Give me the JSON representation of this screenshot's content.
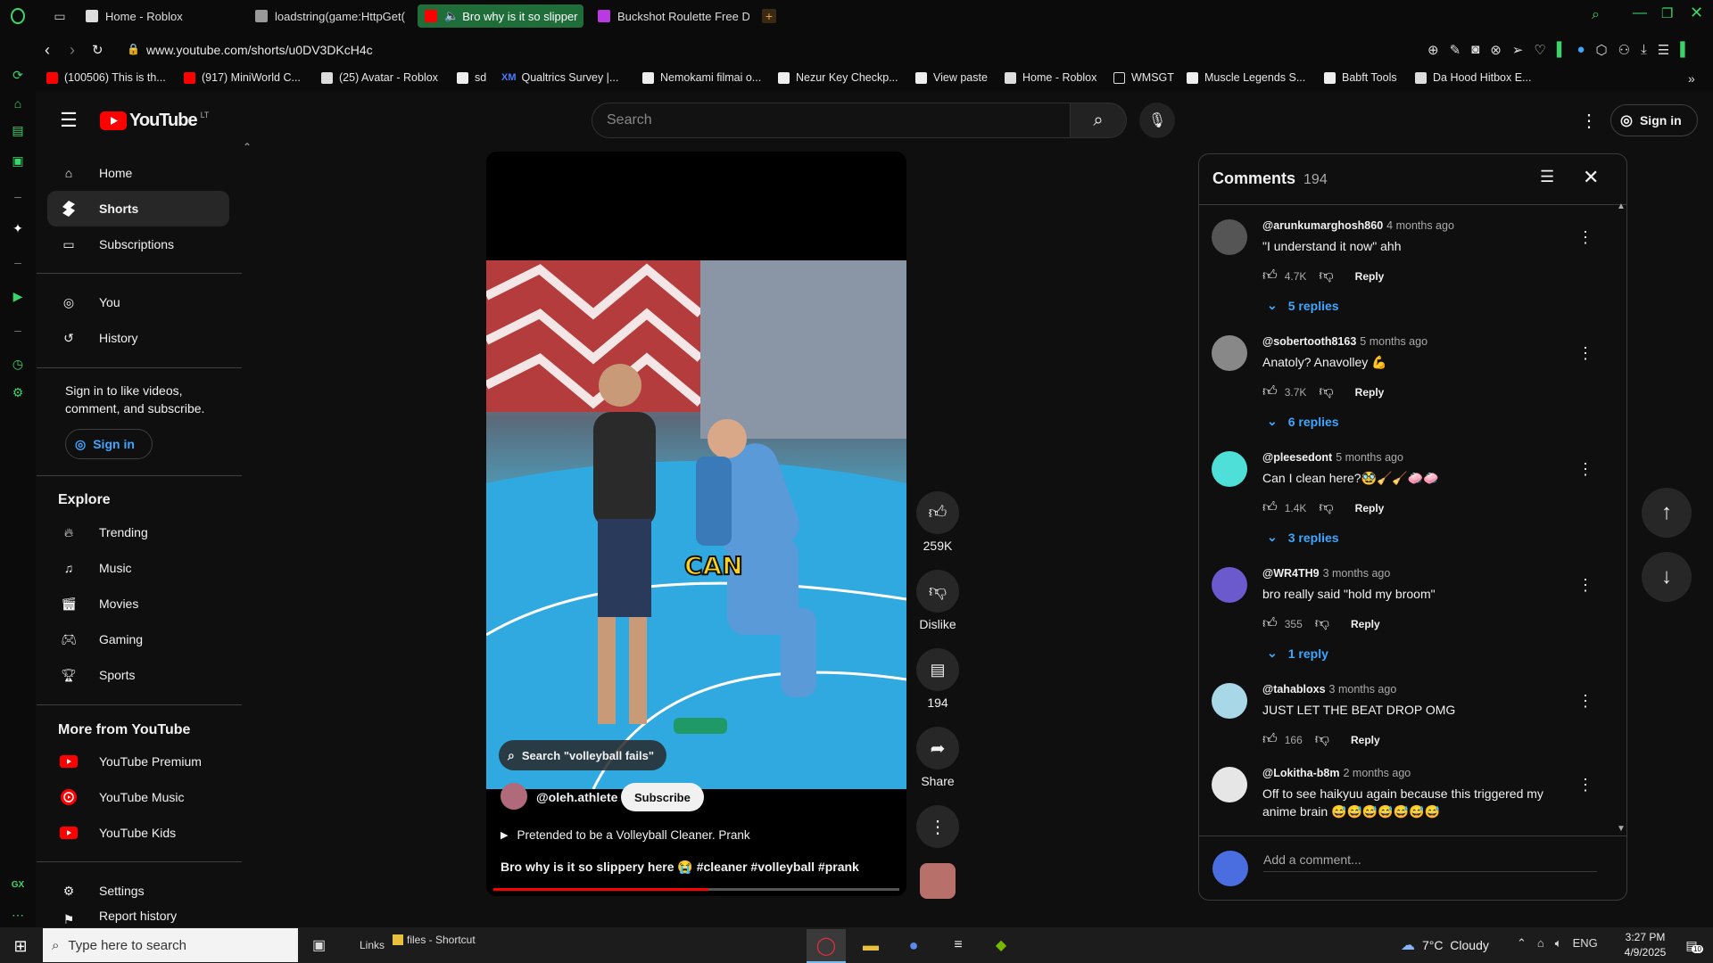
{
  "browser": {
    "tabs": [
      {
        "label": "Home - Roblox",
        "active": false
      },
      {
        "label": "loadstring(game:HttpGet(",
        "active": false
      },
      {
        "label": "Bro why is it so slipper",
        "active": true
      },
      {
        "label": "Buckshot Roulette Free D",
        "active": false
      }
    ],
    "new_tab": "+",
    "url": "www.youtube.com/shorts/u0DV3DKcH4c",
    "bookmarks": [
      "(100506) This is th...",
      "(917) MiniWorld C...",
      "(25) Avatar - Roblox",
      "sd",
      "Qualtrics Survey |...",
      "Nemokami filmai o...",
      "Nezur Key Checkp...",
      "View paste",
      "Home - Roblox",
      "WMSGT",
      "Muscle Legends S...",
      "Babft Tools",
      "Da Hood Hitbox E..."
    ],
    "bookmark_qualtrics_badge": "XM",
    "rail_badge": "GX",
    "accent": "#3ad46b"
  },
  "yt": {
    "logo": "YouTube",
    "country": "LT",
    "search_placeholder": "Search",
    "sign_in": "Sign in",
    "nav": {
      "home": "Home",
      "shorts": "Shorts",
      "subscriptions": "Subscriptions",
      "you": "You",
      "history": "History",
      "signin_prompt": "Sign in to like videos, comment, and subscribe.",
      "signin_button": "Sign in",
      "explore_heading": "Explore",
      "trending": "Trending",
      "music": "Music",
      "movies": "Movies",
      "gaming": "Gaming",
      "sports": "Sports",
      "more_heading": "More from YouTube",
      "premium": "YouTube Premium",
      "yt_music": "YouTube Music",
      "kids": "YouTube Kids",
      "settings": "Settings",
      "report": "Report history"
    }
  },
  "short": {
    "caption_word": "CAN",
    "search_chip": "Search \"volleyball fails\"",
    "channel": "@oleh.athlete",
    "subscribe": "Subscribe",
    "playlist": "Pretended to be a Volleyball Cleaner. Prank",
    "title": "Bro why is it so slippery here 😭 #cleaner #volleyball #prank",
    "progress": 0.53,
    "likes": "259K",
    "dislike": "Dislike",
    "comments": "194",
    "share": "Share"
  },
  "comments": {
    "title": "Comments",
    "count": "194",
    "add_placeholder": "Add a comment...",
    "reply_label": "Reply",
    "items": [
      {
        "author": "@arunkumarghosh860",
        "time": "4 months ago",
        "text": "\"I understand it now\" ahh",
        "likes": "4.7K",
        "replies": "5 replies",
        "avatar": "#555"
      },
      {
        "author": "@sobertooth8163",
        "time": "5 months ago",
        "text": "Anatoly? Anavolley 💪",
        "likes": "3.7K",
        "replies": "6 replies",
        "avatar": "#888"
      },
      {
        "author": "@pleesedont",
        "time": "5 months ago",
        "text": "Can I clean here?🥸🧹🧹🧼🧼",
        "likes": "1.4K",
        "replies": "3 replies",
        "avatar": "#4ee0d8"
      },
      {
        "author": "@WR4TH9",
        "time": "3 months ago",
        "text": "bro really said \"hold my broom\"",
        "likes": "355",
        "replies": "1 reply",
        "avatar": "#6a5acd"
      },
      {
        "author": "@tahabloxs",
        "time": "3 months ago",
        "text": "JUST LET THE BEAT DROP OMG",
        "likes": "166",
        "replies": "",
        "avatar": "#a8d8e8"
      },
      {
        "author": "@Lokitha-b8m",
        "time": "2 months ago",
        "text": "Off to see haikyuu again because this triggered my anime brain 😅😅😅😅😅😅😅",
        "likes": "",
        "replies": "",
        "avatar": "#e6e6e6"
      }
    ]
  },
  "taskbar": {
    "search_placeholder": "Type here to search",
    "links": "Links",
    "files": "files - Shortcut",
    "weather": "7°C  Cloudy",
    "lang": "ENG",
    "time": "3:27 PM",
    "date": "4/9/2025",
    "notif": "10"
  }
}
